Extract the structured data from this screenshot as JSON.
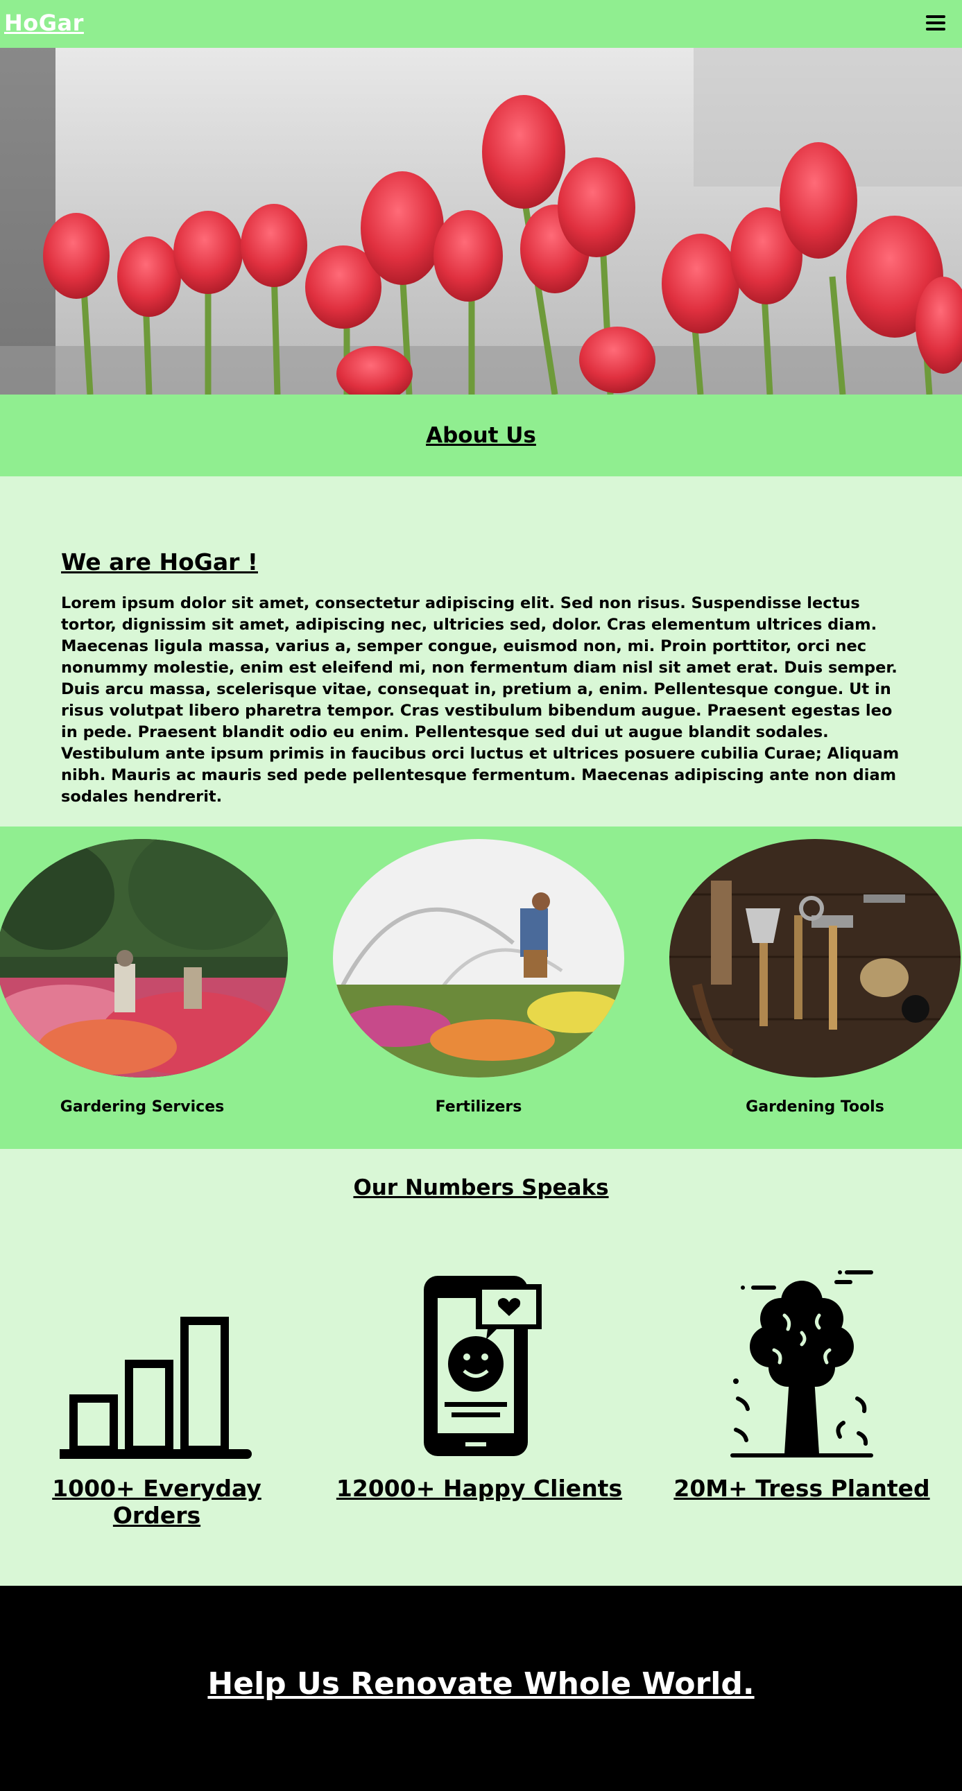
{
  "header": {
    "brand": "HoGar",
    "menu_icon": "hamburger-menu-icon"
  },
  "hero": {
    "image": "red tulips photo"
  },
  "about": {
    "title": "About Us",
    "heading": "We are HoGar !",
    "text": "Lorem ipsum dolor sit amet, consectetur adipiscing elit. Sed non risus. Suspendisse lectus tortor, dignissim sit amet, adipiscing nec, ultricies sed, dolor. Cras elementum ultrices diam. Maecenas ligula massa, varius a, semper congue, euismod non, mi. Proin porttitor, orci nec nonummy molestie, enim est eleifend mi, non fermentum diam nisl sit amet erat. Duis semper. Duis arcu massa, scelerisque vitae, consequat in, pretium a, enim. Pellentesque congue. Ut in risus volutpat libero pharetra tempor. Cras vestibulum bibendum augue. Praesent egestas leo in pede. Praesent blandit odio eu enim. Pellentesque sed dui ut augue blandit sodales. Vestibulum ante ipsum primis in faucibus orci luctus et ultrices posuere cubilia Curae; Aliquam nibh. Mauris ac mauris sed pede pellentesque fermentum. Maecenas adipiscing ante non diam sodales hendrerit."
  },
  "services": [
    {
      "label": "Gardering Services"
    },
    {
      "label": "Fertilizers"
    },
    {
      "label": "Gardening Tools"
    }
  ],
  "numbers": {
    "title": "Our Numbers Speaks",
    "stats": [
      {
        "value": "1000+ Everyday Orders",
        "icon": "bar-chart-icon"
      },
      {
        "value": "12000+ Happy Clients",
        "icon": "smartphone-smiley-icon"
      },
      {
        "value": "20M+ Tress Planted",
        "icon": "tree-icon"
      }
    ]
  },
  "footer": {
    "title": "Help Us Renovate Whole World."
  },
  "colors": {
    "primary_green": "#90ee90",
    "light_green": "#d9f7d6",
    "footer_bg": "#000000"
  }
}
